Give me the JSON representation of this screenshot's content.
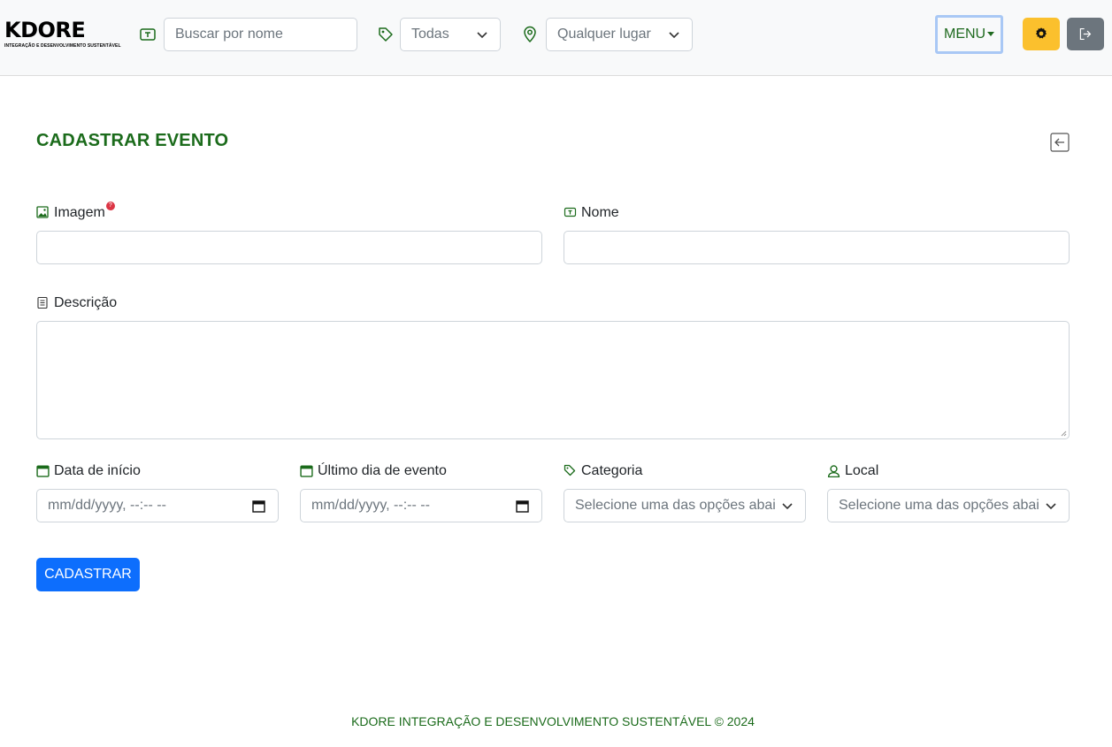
{
  "brand": {
    "name": "KDORE",
    "tagline": "INTEGRAÇÃO E DESENVOLVIMENTO SUSTENTÁVEL"
  },
  "header": {
    "search_placeholder": "Buscar por nome",
    "category_value": "Todas",
    "location_value": "Qualquer lugar",
    "menu_label": "MENU"
  },
  "page": {
    "title": "CADASTRAR EVENTO"
  },
  "form": {
    "image_label": "Imagem",
    "image_help": "?",
    "name_label": "Nome",
    "description_label": "Descrição",
    "start_label": "Data de início",
    "start_placeholder": "mm/dd/yyyy, --:-- --",
    "end_label": "Último dia de evento",
    "end_placeholder": "mm/dd/yyyy, --:-- --",
    "category_label": "Categoria",
    "category_placeholder": "Selecione uma das opções abai",
    "local_label": "Local",
    "local_placeholder": "Selecione uma das opções abai",
    "submit_label": "CADASTRAR"
  },
  "footer": {
    "text": "KDORE INTEGRAÇÃO E DESENVOLVIMENTO SUSTENTÁVEL © 2024"
  },
  "colors": {
    "brand_green": "#1b6b1b",
    "primary": "#0d6efd",
    "warning": "#fbc02d",
    "secondary": "#6c757d",
    "danger": "#dc3545"
  },
  "icons": [
    "ticket-icon",
    "tag-icon",
    "map-pin-icon",
    "chevron-down-icon",
    "gear-icon",
    "logout-icon",
    "back-arrow-icon",
    "image-icon",
    "file-text-icon",
    "calendar-icon",
    "user-pin-icon"
  ]
}
